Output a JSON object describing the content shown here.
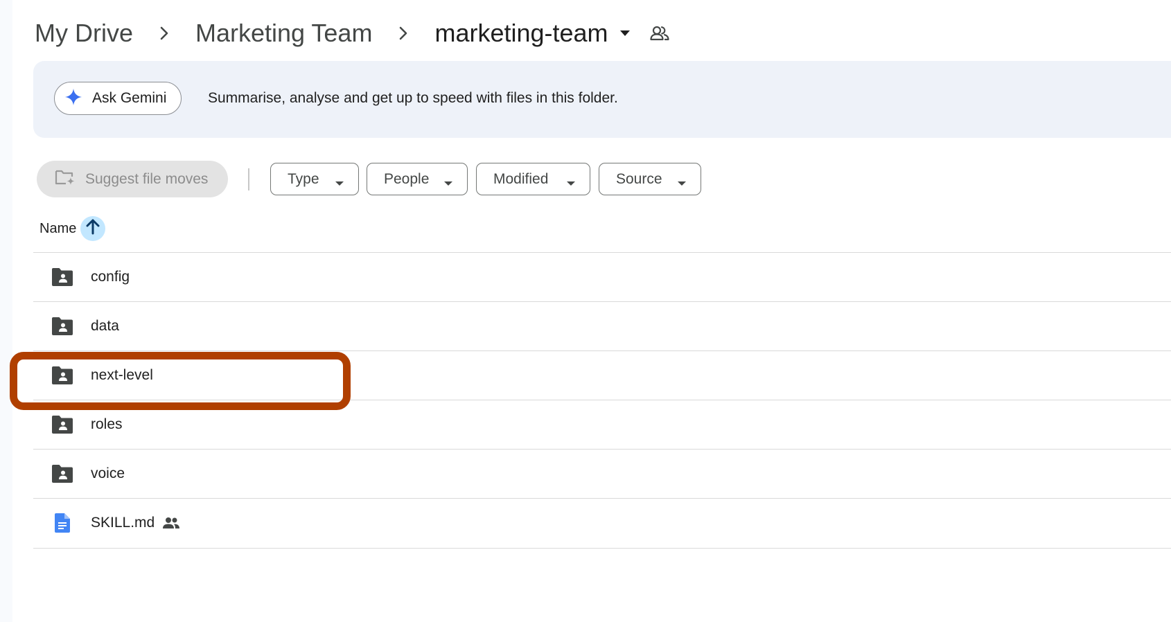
{
  "breadcrumb": {
    "items": [
      {
        "label": "My Drive"
      },
      {
        "label": "Marketing Team"
      },
      {
        "label": "marketing-team"
      }
    ],
    "separator_icon": "chevron-right-icon",
    "dropdown_icon": "caret-down-icon",
    "shared_icon": "shared-folder-icon"
  },
  "gemini": {
    "button_label": "Ask Gemini",
    "icon": "gemini-sparkle-icon",
    "description": "Summarise, analyse and get up to speed with files in this folder.",
    "accent": "#3a6ff0"
  },
  "filters": {
    "suggest_label": "Suggest file moves",
    "suggest_icon": "folder-sparkle-icon",
    "chips": [
      {
        "label": "Type"
      },
      {
        "label": "People"
      },
      {
        "label": "Modified"
      },
      {
        "label": "Source"
      }
    ]
  },
  "list": {
    "header_label": "Name",
    "sort": "ascending",
    "sort_icon": "arrow-up-icon",
    "rows": [
      {
        "name": "config",
        "icon": "shared-folder-icon",
        "shared": false
      },
      {
        "name": "data",
        "icon": "shared-folder-icon",
        "shared": false
      },
      {
        "name": "next-level",
        "icon": "shared-folder-icon",
        "shared": false,
        "highlighted": true
      },
      {
        "name": "roles",
        "icon": "shared-folder-icon",
        "shared": false
      },
      {
        "name": "voice",
        "icon": "shared-folder-icon",
        "shared": false
      },
      {
        "name": "SKILL.md",
        "icon": "doc-icon",
        "shared": true
      }
    ]
  },
  "colors": {
    "banner_bg": "#eef2f9",
    "sort_bg": "#c2e7ff",
    "highlight": "#b03f00",
    "doc_blue": "#4285f4"
  }
}
